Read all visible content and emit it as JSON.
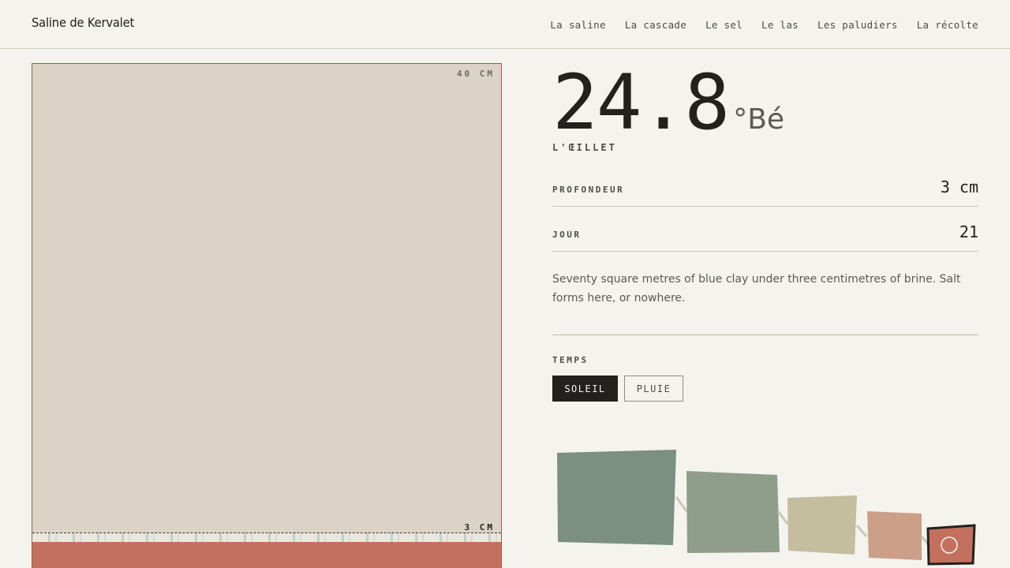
{
  "header": {
    "brand": "Saline de Kervalet",
    "nav": [
      "La saline",
      "La cascade",
      "Le sel",
      "Le las",
      "Les paludiers",
      "La récolte"
    ]
  },
  "pan": {
    "top_label": "40 CM",
    "bottom_label": "3 CM",
    "brine_depth_cm": 3,
    "max_depth_cm": 40
  },
  "reading": {
    "value": "24.8",
    "unit": "°Bé",
    "pan_name": "L'ŒILLET"
  },
  "stats": [
    {
      "key": "PROFONDEUR",
      "value": "3 cm"
    },
    {
      "key": "JOUR",
      "value": "21"
    }
  ],
  "description": "Seventy square metres of blue clay under three centimetres of brine. Salt forms here, or nowhere.",
  "weather": {
    "label": "TEMPS",
    "options": [
      "SOLEIL",
      "PLUIE"
    ],
    "selected": "SOLEIL"
  },
  "colors": {
    "background": "#f4f3ee",
    "ink": "#22211d",
    "clay": "#dbd3c6",
    "brine": "#c4705e",
    "pan_border": "#b5553f",
    "cascade": [
      "#7b8f83",
      "#909d8a",
      "#c4bd9e",
      "#cc9f88",
      "#c4705e"
    ]
  },
  "cascade": {
    "active_index": 4,
    "active_icon": "circle-marker-icon"
  }
}
